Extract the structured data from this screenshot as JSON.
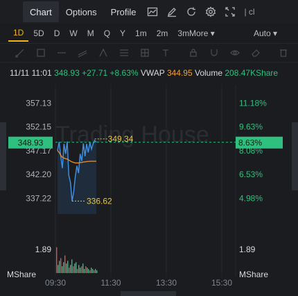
{
  "tabs": [
    {
      "label": "Chart",
      "active": true
    },
    {
      "label": "Options",
      "active": false
    },
    {
      "label": "Profile",
      "active": false
    }
  ],
  "toolbar_icons": [
    "line-chart-icon",
    "edit-icon",
    "refresh-icon",
    "settings-icon",
    "fullscreen-icon"
  ],
  "toolbar_tail": "| cl",
  "timeframes": [
    {
      "label": "1D",
      "active": true
    },
    {
      "label": "5D"
    },
    {
      "label": "D"
    },
    {
      "label": "W"
    },
    {
      "label": "M"
    },
    {
      "label": "Q"
    },
    {
      "label": "Y"
    },
    {
      "label": "1m"
    },
    {
      "label": "2m"
    },
    {
      "label": "3mMore ▾"
    }
  ],
  "auto_label": "Auto ▾",
  "quote": {
    "time": "11/11 11:01",
    "price": "348.93",
    "change": "+27.71",
    "change_pct": "+8.63%",
    "vwap_label": "VWAP",
    "vwap": "344.95",
    "volume_label": "Volume",
    "volume": "208.47KShare"
  },
  "watermark": "Trading House",
  "colors": {
    "up": "#2ec07f",
    "price_line": "#3d8ee0",
    "vwap_line": "#e08a2a",
    "label_yellow": "#e6c64a",
    "current_tag": "#2ec07f"
  },
  "chart_data": {
    "type": "line",
    "y_left_ticks": [
      "357.13",
      "352.15",
      "347.17",
      "342.20",
      "337.22"
    ],
    "y_right_ticks": [
      "11.18%",
      "9.63%",
      "8.08%",
      "6.53%",
      "4.98%"
    ],
    "current_price": "348.93",
    "current_pct": "8.63%",
    "high_label": "349.34",
    "low_label": "336.62",
    "x_ticks": [
      "09:30",
      "11:30",
      "13:30",
      "15:30"
    ],
    "volume_axis_left": "1.89",
    "volume_axis_right": "1.89",
    "volume_unit_left": "MShare",
    "volume_unit_right": "MShare",
    "ylim": [
      334.5,
      359.5
    ],
    "series": [
      {
        "name": "Price",
        "values": [
          347.2,
          349.0,
          346.0,
          343.5,
          348.6,
          346.5,
          349.1,
          342.0,
          340.5,
          336.6,
          338.5,
          341.8,
          344.0,
          342.5,
          346.5,
          345.0,
          348.7,
          346.0,
          348.6,
          346.8,
          348.9,
          347.5,
          348.6,
          349.34,
          348.93
        ]
      },
      {
        "name": "VWAP",
        "values": [
          347.2,
          346.8,
          346.2,
          345.8,
          345.6,
          345.5,
          345.4,
          345.2,
          345.0,
          344.8,
          344.7,
          344.6,
          344.6,
          344.6,
          344.7,
          344.7,
          344.8,
          344.8,
          344.9,
          344.9,
          344.95,
          344.95,
          344.95,
          344.95,
          344.95
        ]
      }
    ],
    "volume": [
      1.9,
      0.6,
      0.9,
      1.1,
      0.5,
      0.8,
      1.3,
      0.7,
      0.9,
      0.4,
      0.6,
      1.0,
      0.5,
      0.7,
      0.8,
      0.3,
      0.6,
      0.4,
      0.5,
      0.7,
      0.3,
      0.5,
      0.4,
      0.3,
      0.2,
      0.4,
      0.3,
      0.2,
      0.3,
      0.2
    ]
  }
}
